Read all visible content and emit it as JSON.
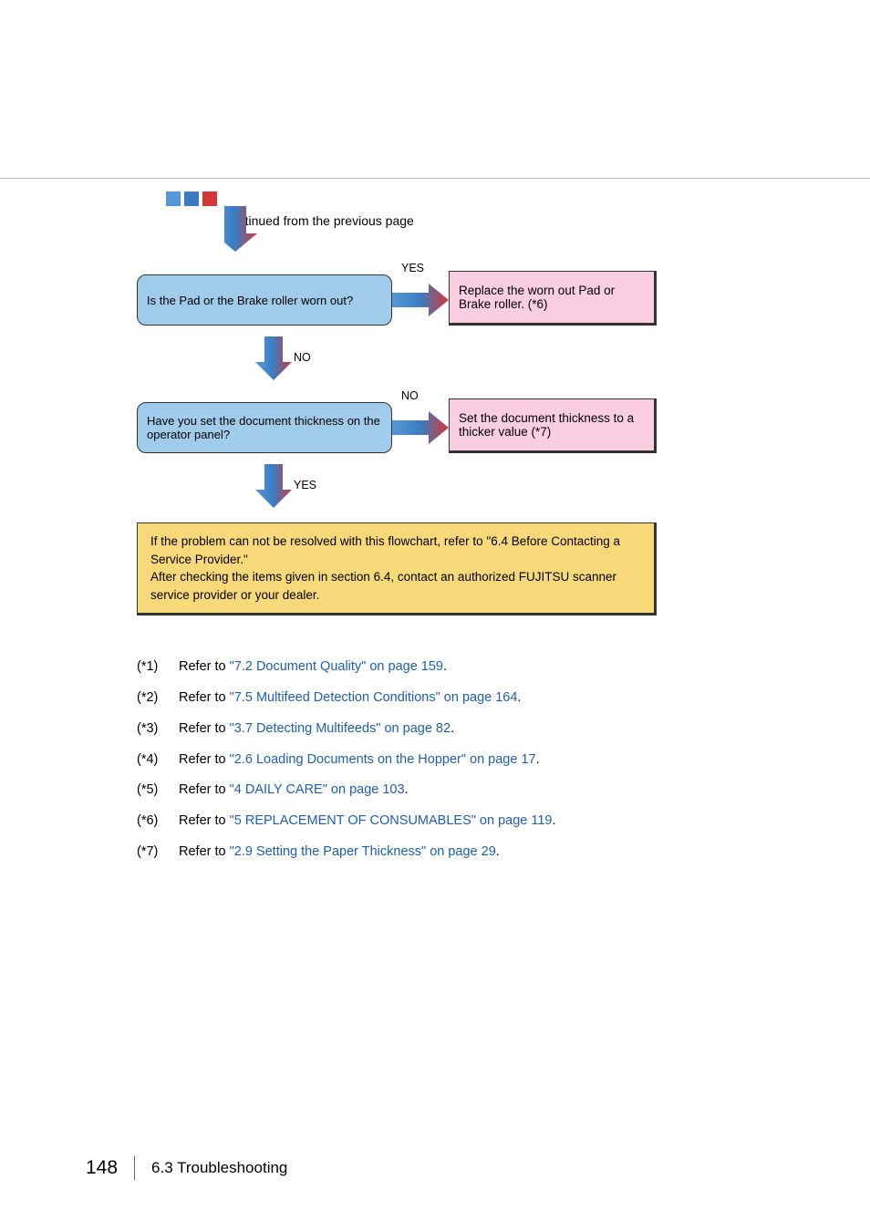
{
  "flow": {
    "continued": "continued from the previous page",
    "q1": "Is the Pad or the Brake roller worn out?",
    "a1": "Replace the worn out Pad or Brake roller. (*6)",
    "yes1": "YES",
    "no1": "NO",
    "q2_a": "Have you set the document thickness ",
    "q2_b": "on",
    "q2_c": " the operator panel?",
    "a2": "Set the document thickness to a thicker value (*7)",
    "no2": "NO",
    "yes2": "YES",
    "final": "If the problem can not be resolved with this flowchart, refer to \"6.4 Before Contacting a Service Provider.\"\nAfter checking the items given in section 6.4, contact an authorized FUJITSU scanner service provider or your dealer."
  },
  "notes": [
    {
      "num": "(*1)",
      "pre": "Refer to ",
      "link": "\"7.2 Document Quality\" on page 159",
      "post": "."
    },
    {
      "num": "(*2)",
      "pre": "Refer to ",
      "link": "\"7.5 Multifeed Detection Conditions\" on page 164",
      "post": "."
    },
    {
      "num": "(*3)",
      "pre": "Refer to ",
      "link": "\"3.7 Detecting Multifeeds\" on page 82",
      "post": "."
    },
    {
      "num": "(*4)",
      "pre": "Refer to ",
      "link": "\"2.6 Loading Documents on the Hopper\" on page 17",
      "post": "."
    },
    {
      "num": "(*5)",
      "pre": "Refer to ",
      "link": "\"4  DAILY CARE\" on page 103",
      "post": "."
    },
    {
      "num": "(*6)",
      "pre": "Refer to ",
      "link": "\"5 REPLACEMENT OF CONSUMABLES\" on page 119",
      "post": "."
    },
    {
      "num": "(*7)",
      "pre": "Refer to ",
      "link": "\"2.9 Setting the Paper Thickness\" on page 29",
      "post": "."
    }
  ],
  "footer": {
    "page": "148",
    "section": "6.3 Troubleshooting"
  }
}
